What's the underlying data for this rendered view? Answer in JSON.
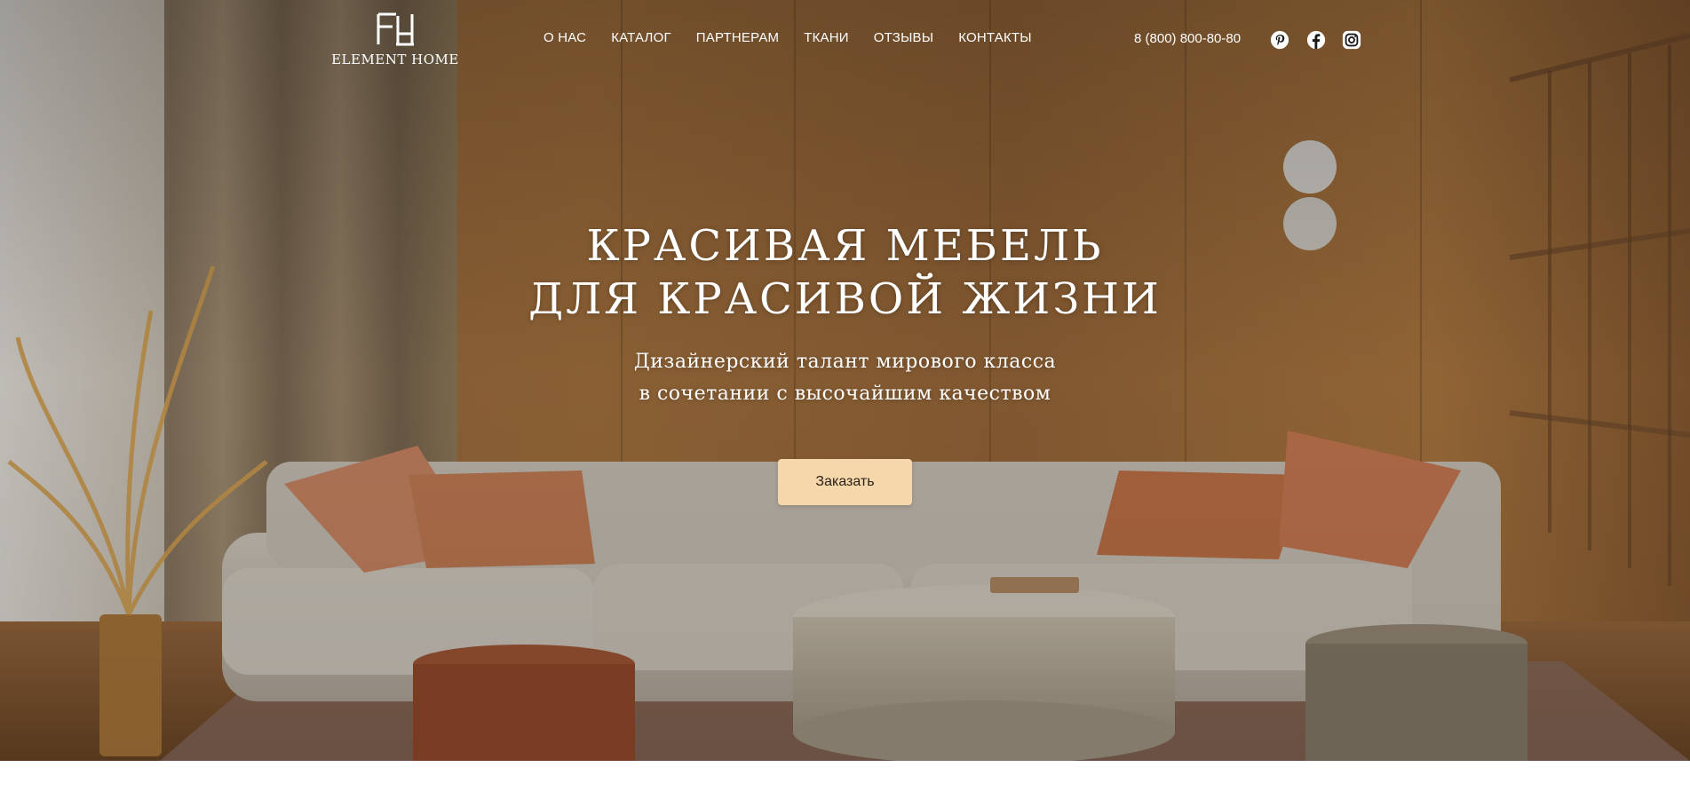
{
  "brand": {
    "name": "ELEMENT HOME",
    "logo_icon": "fh-monogram-icon"
  },
  "nav": {
    "items": [
      {
        "label": "О НАС"
      },
      {
        "label": "КАТАЛОГ"
      },
      {
        "label": "ПАРТНЕРАМ"
      },
      {
        "label": "ТКАНИ"
      },
      {
        "label": "ОТЗЫВЫ"
      },
      {
        "label": "КОНТАКТЫ"
      }
    ]
  },
  "contact": {
    "phone": "8 (800) 800-80-80"
  },
  "social": [
    {
      "icon": "pinterest-icon"
    },
    {
      "icon": "facebook-icon"
    },
    {
      "icon": "instagram-icon"
    }
  ],
  "hero": {
    "title_line1": "КРАСИВАЯ МЕБЕЛЬ",
    "title_line2": "ДЛЯ КРАСИВОЙ ЖИЗНИ",
    "subtitle_line1": "Дизайнерский талант мирового класса",
    "subtitle_line2": "в сочетании с высочайшим качеством",
    "cta_label": "Заказать",
    "background_image": "living-room-with-sofa-photo"
  },
  "colors": {
    "cta_background": "#f6d6ab",
    "cta_text": "#2b2118",
    "header_text": "#ffffff"
  }
}
